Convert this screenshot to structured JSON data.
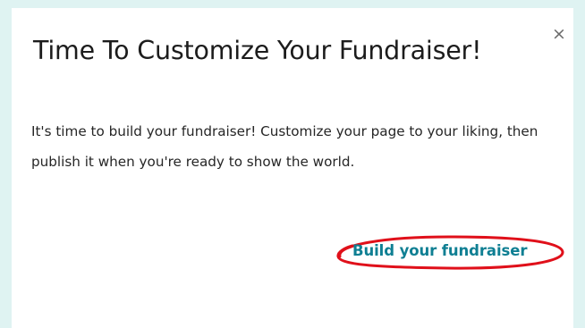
{
  "dialog": {
    "title": "Time To Customize Your Fundraiser!",
    "close_label": "×",
    "body": "It's time to build your fundraiser! Customize your page to your liking, then publish it when you're ready to show the world.",
    "link_label": "Build your fundraiser"
  },
  "colors": {
    "background": "#dff3f2",
    "dialog_background": "#ffffff",
    "link": "#0f7f93",
    "highlight_circle": "#e0101a"
  }
}
